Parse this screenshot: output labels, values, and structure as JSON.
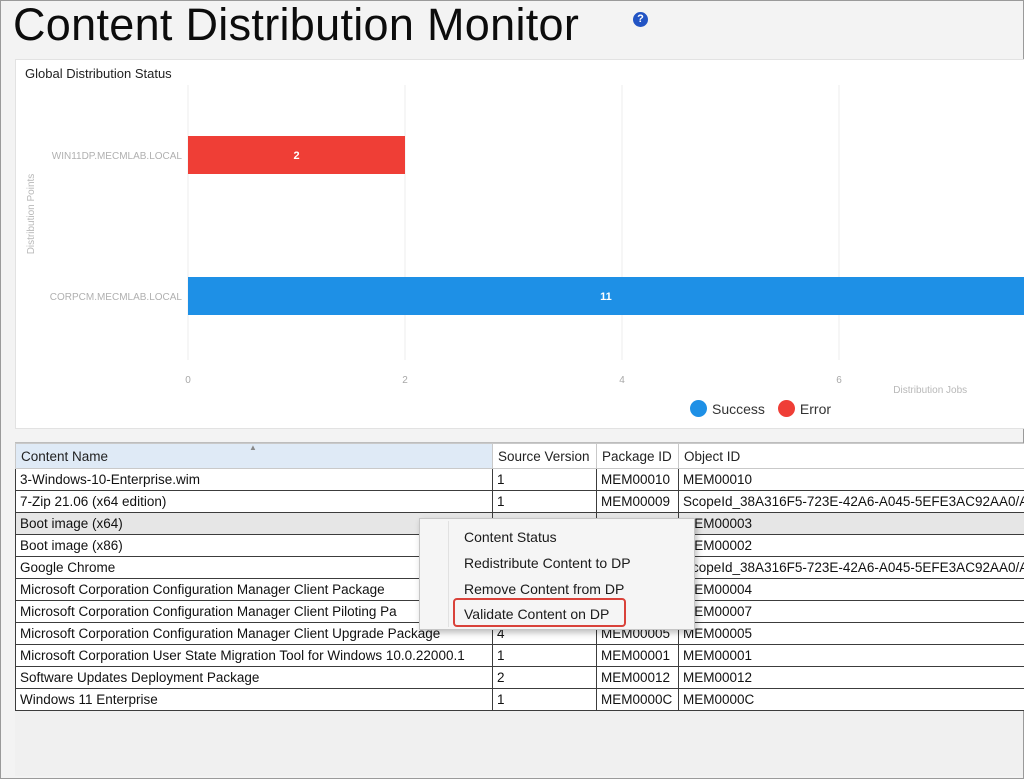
{
  "page": {
    "title": "Content Distribution Monitor",
    "help_glyph": "?"
  },
  "chart_data": {
    "type": "bar",
    "orientation": "horizontal",
    "title": "Global Distribution Status",
    "xlabel": "Distribution Jobs",
    "ylabel": "Distribution Points",
    "categories": [
      "WIN11DP.MECMLAB.LOCAL",
      "CORPCM.MECMLAB.LOCAL"
    ],
    "series": [
      {
        "name": "Error",
        "color": "#ef3e36",
        "values": [
          2,
          0
        ]
      },
      {
        "name": "Success",
        "color": "#1e90e6",
        "values": [
          0,
          11
        ]
      }
    ],
    "x_ticks": [
      "0",
      "2",
      "4",
      "6"
    ],
    "xlim": [
      0,
      8
    ],
    "grid": true,
    "legend_position": "bottom-right"
  },
  "table": {
    "columns": [
      "Content Name",
      "Source Version",
      "Package ID",
      "Object ID"
    ],
    "rows": [
      [
        "3-Windows-10-Enterprise.wim",
        "1",
        "MEM00010",
        "MEM00010"
      ],
      [
        "7-Zip 21.06 (x64 edition)",
        "1",
        "MEM00009",
        "ScopeId_38A316F5-723E-42A6-A045-5EFE3AC92AA0/A"
      ],
      [
        "Boot image (x64)",
        "",
        "",
        "MEM00003"
      ],
      [
        "Boot image (x86)",
        "",
        "",
        "MEM00002"
      ],
      [
        "Google Chrome",
        "",
        "",
        "ScopeId_38A316F5-723E-42A6-A045-5EFE3AC92AA0/A"
      ],
      [
        "Microsoft Corporation Configuration Manager Client Package",
        "",
        "",
        "MEM00004"
      ],
      [
        "Microsoft Corporation Configuration Manager Client Piloting Pa",
        "",
        "",
        "MEM00007"
      ],
      [
        "Microsoft Corporation Configuration Manager Client Upgrade Package",
        "4",
        "MEM00005",
        "MEM00005"
      ],
      [
        "Microsoft Corporation User State Migration Tool for Windows 10.0.22000.1",
        "1",
        "MEM00001",
        "MEM00001"
      ],
      [
        "Software Updates Deployment Package",
        "2",
        "MEM00012",
        "MEM00012"
      ],
      [
        "Windows 11 Enterprise",
        "1",
        "MEM0000C",
        "MEM0000C"
      ]
    ]
  },
  "context_menu": {
    "items": [
      "Content Status",
      "Redistribute Content to DP",
      "Remove Content from DP",
      "Validate Content on DP"
    ],
    "highlighted": "Validate Content on DP",
    "highlight_color": "#d9423a"
  }
}
